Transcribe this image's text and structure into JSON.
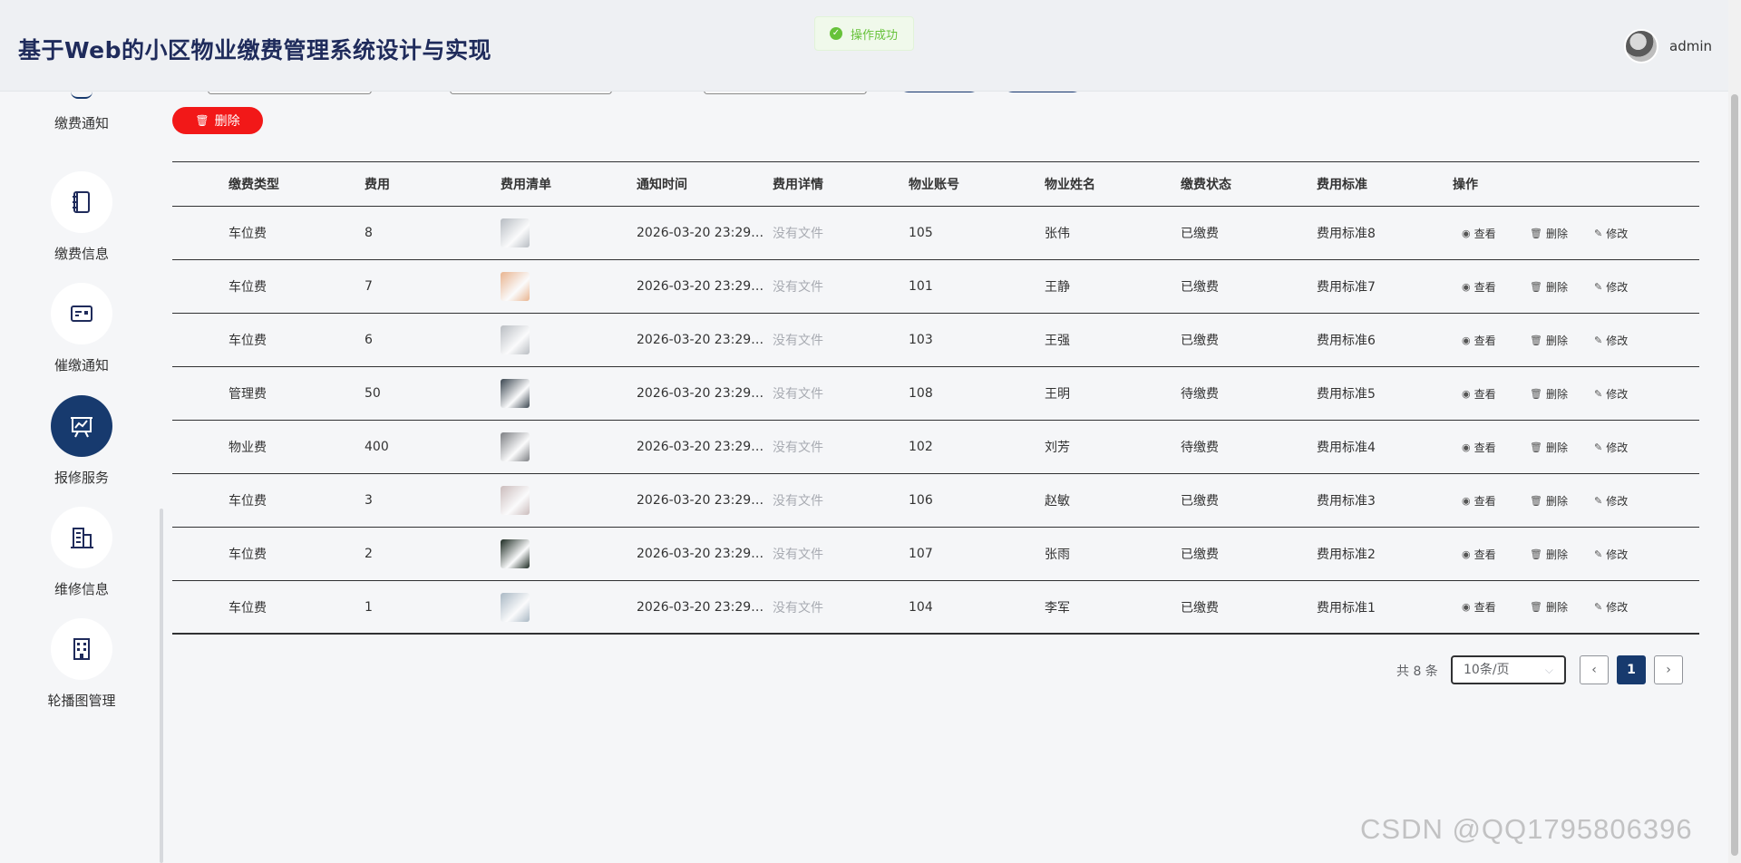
{
  "header": {
    "title": "基于Web的小区物业缴费管理系统设计与实现",
    "username": "admin",
    "toast": "操作成功"
  },
  "sidebar": {
    "items": [
      {
        "label": "缴费通知",
        "icon": "notice-icon"
      },
      {
        "label": "缴费信息",
        "icon": "notebook-icon"
      },
      {
        "label": "催缴通知",
        "icon": "card-icon"
      },
      {
        "label": "报修服务",
        "icon": "presentation-chart-icon"
      },
      {
        "label": "维修信息",
        "icon": "office-building-icon"
      },
      {
        "label": "轮播图管理",
        "icon": "building-icon"
      }
    ],
    "active_index": 3
  },
  "toolbar": {
    "delete_label": "删除"
  },
  "table": {
    "headers": [
      "缴费类型",
      "费用",
      "费用清单",
      "通知时间",
      "费用详情",
      "物业账号",
      "物业姓名",
      "缴费状态",
      "费用标准",
      "操作"
    ],
    "rows": [
      {
        "type": "车位费",
        "fee": "8",
        "time": "2026-03-20 23:29…",
        "detail": "没有文件",
        "account": "105",
        "name": "张伟",
        "status": "已缴费",
        "standard": "费用标准8",
        "thumb": "#b7bcc2"
      },
      {
        "type": "车位费",
        "fee": "7",
        "time": "2026-03-20 23:29…",
        "detail": "没有文件",
        "account": "101",
        "name": "王静",
        "status": "已缴费",
        "standard": "费用标准7",
        "thumb": "#e9b48f"
      },
      {
        "type": "车位费",
        "fee": "6",
        "time": "2026-03-20 23:29…",
        "detail": "没有文件",
        "account": "103",
        "name": "王强",
        "status": "已缴费",
        "standard": "费用标准6",
        "thumb": "#b9bdc2"
      },
      {
        "type": "管理费",
        "fee": "50",
        "time": "2026-03-20 23:29…",
        "detail": "没有文件",
        "account": "108",
        "name": "王明",
        "status": "待缴费",
        "standard": "费用标准5",
        "thumb": "#3b4650"
      },
      {
        "type": "物业费",
        "fee": "400",
        "time": "2026-03-20 23:29…",
        "detail": "没有文件",
        "account": "102",
        "name": "刘芳",
        "status": "待缴费",
        "standard": "费用标准4",
        "thumb": "#7d7f83"
      },
      {
        "type": "车位费",
        "fee": "3",
        "time": "2026-03-20 23:29…",
        "detail": "没有文件",
        "account": "106",
        "name": "赵敏",
        "status": "已缴费",
        "standard": "费用标准3",
        "thumb": "#cbbcbc"
      },
      {
        "type": "车位费",
        "fee": "2",
        "time": "2026-03-20 23:29…",
        "detail": "没有文件",
        "account": "107",
        "name": "张雨",
        "status": "已缴费",
        "standard": "费用标准2",
        "thumb": "#1c2a22"
      },
      {
        "type": "车位费",
        "fee": "1",
        "time": "2026-03-20 23:29…",
        "detail": "没有文件",
        "account": "104",
        "name": "李军",
        "status": "已缴费",
        "standard": "费用标准1",
        "thumb": "#a9b8c4"
      }
    ],
    "actions": {
      "view": "查看",
      "delete": "删除",
      "edit": "修改"
    }
  },
  "pagination": {
    "total": "共 8 条",
    "page_size": "10条/页",
    "current_page": "1",
    "prev": "‹",
    "next": "›"
  },
  "watermark": "CSDN @QQ1795806396",
  "colors": {
    "primary": "#173a6e",
    "danger": "#f21818",
    "success": "#67c23a"
  }
}
